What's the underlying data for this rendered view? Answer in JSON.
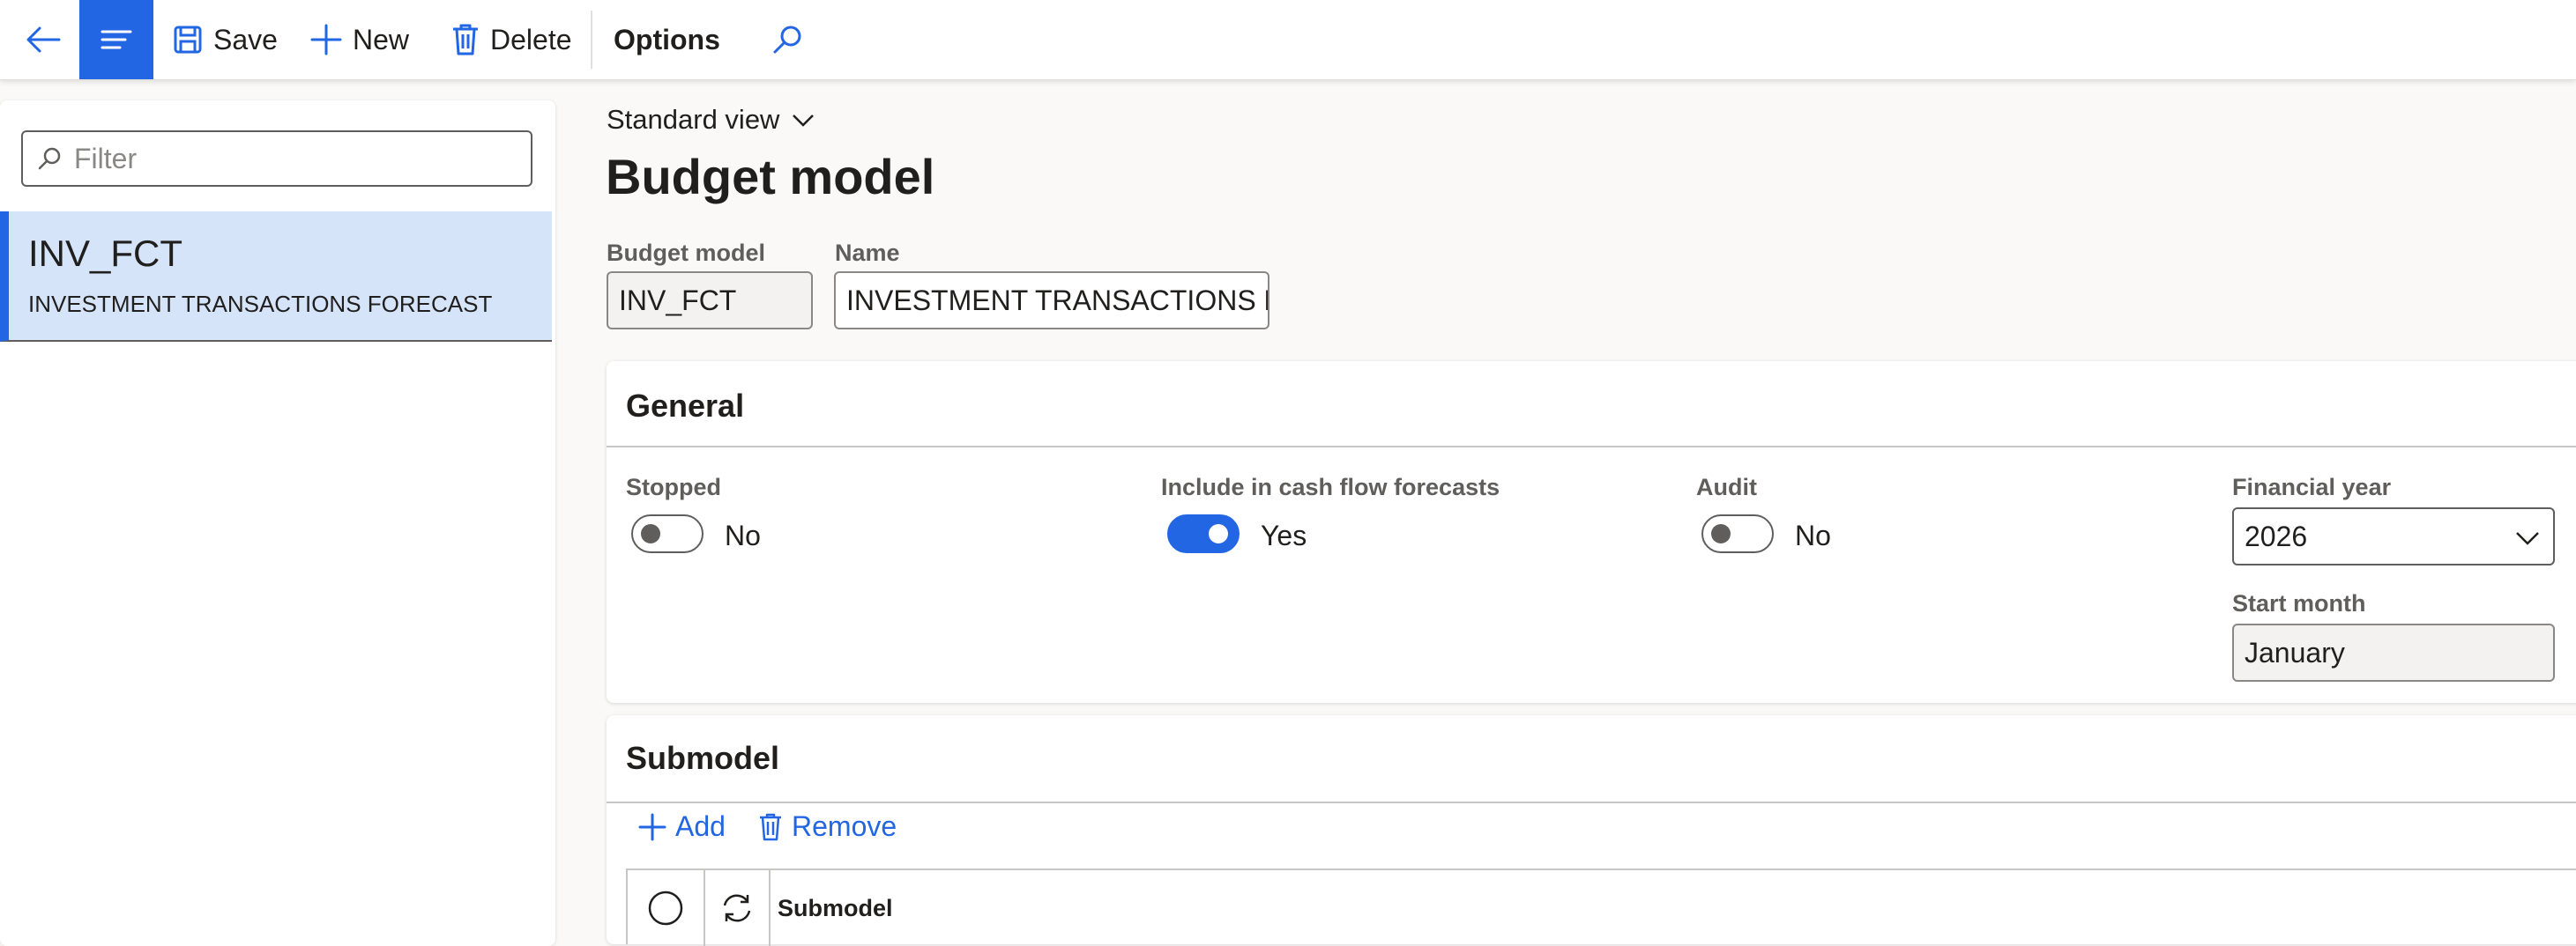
{
  "toolbar": {
    "save_label": "Save",
    "new_label": "New",
    "delete_label": "Delete",
    "options_label": "Options"
  },
  "leftpane": {
    "filter_placeholder": "Filter",
    "items": [
      {
        "id": "INV_FCT",
        "name": "INVESTMENT TRANSACTIONS FORECAST"
      }
    ]
  },
  "main": {
    "view_label": "Standard view",
    "page_title": "Budget model",
    "budget_model_label": "Budget model",
    "budget_model_value": "INV_FCT",
    "name_label": "Name",
    "name_value": "INVESTMENT TRANSACTIONS F..."
  },
  "general": {
    "header": "General",
    "stopped": {
      "label": "Stopped",
      "value": "No",
      "on": false
    },
    "cashflow": {
      "label": "Include in cash flow forecasts",
      "value": "Yes",
      "on": true
    },
    "audit": {
      "label": "Audit",
      "value": "No",
      "on": false
    },
    "financial_year": {
      "label": "Financial year",
      "value": "2026"
    },
    "start_month": {
      "label": "Start month",
      "value": "January"
    }
  },
  "submodel": {
    "header": "Submodel",
    "add_label": "Add",
    "remove_label": "Remove",
    "column_header": "Submodel"
  },
  "colors": {
    "accent": "#2266e3",
    "selection": "#d6e4fa"
  }
}
